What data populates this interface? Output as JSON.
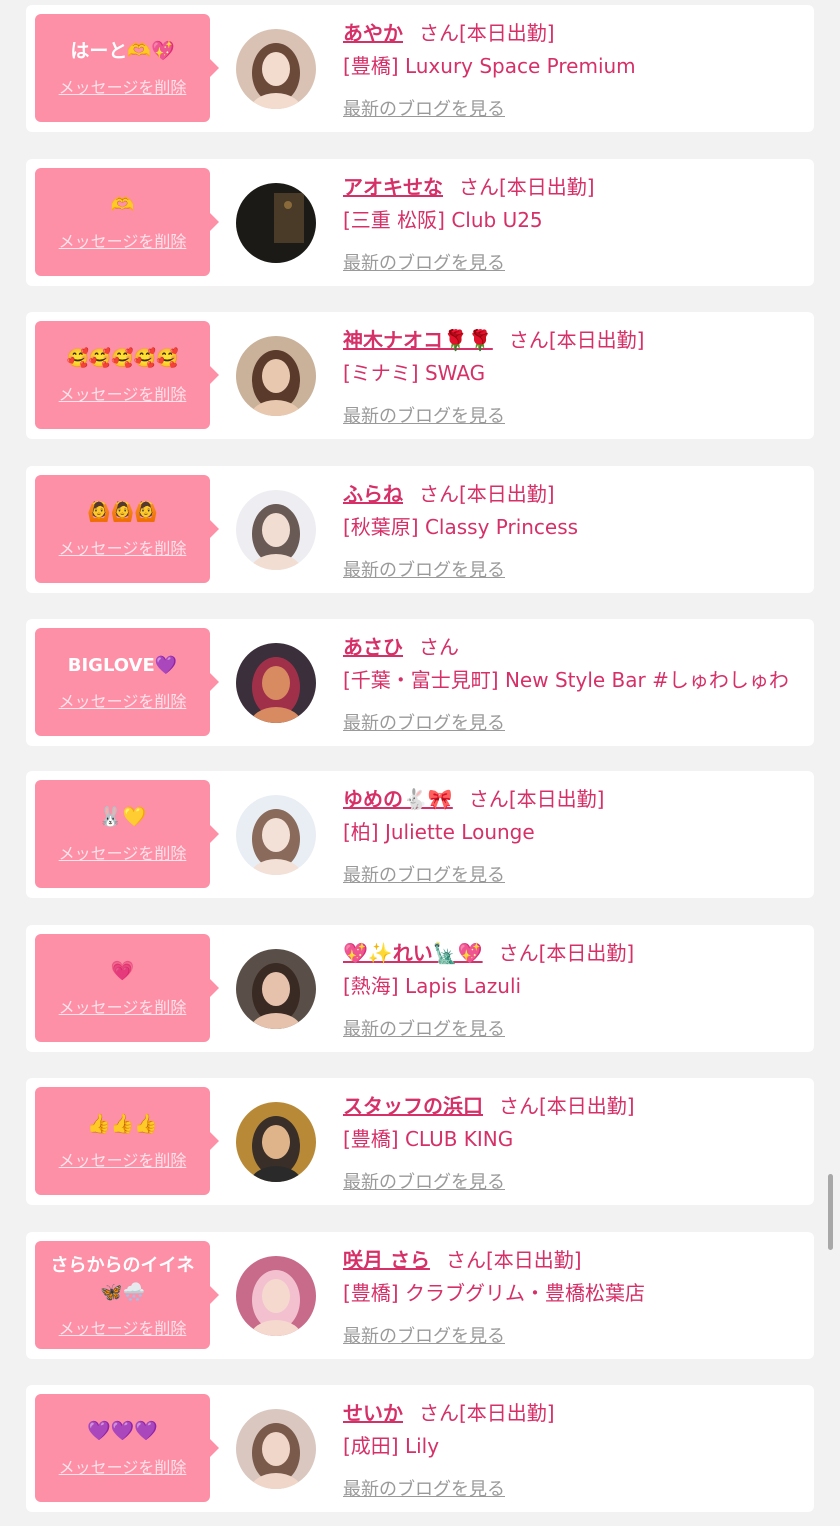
{
  "common": {
    "delete_label": "メッセージを削除",
    "blog_label": "最新のブログを見る",
    "san_label": "さん"
  },
  "colors": {
    "page_bg": "#f2f2f2",
    "bubble": "#fd8fa6",
    "accent": "#d63068",
    "link_gray": "#9a9a9a"
  },
  "items": [
    {
      "message": "はーと🫶💖",
      "name": "あやか",
      "status": "[本日出勤]",
      "shop": "[豊橋] Luxury Space Premium",
      "avatar": "avatar-woman-icon"
    },
    {
      "message": "🫶",
      "name": "アオキせな",
      "status": "[本日出勤]",
      "shop": "[三重 松阪] Club U25",
      "avatar": "avatar-night-icon"
    },
    {
      "message": "🥰🥰🥰🥰🥰",
      "name": "神木ナオコ🌹🌹",
      "status": "[本日出勤]",
      "shop": "[ミナミ] SWAG",
      "avatar": "avatar-woman-icon"
    },
    {
      "message": "🙆🙆🙆",
      "name": "ふらね",
      "status": "[本日出勤]",
      "shop": "[秋葉原] Classy Princess",
      "avatar": "avatar-woman-icon"
    },
    {
      "message": "BIGLOVE💜",
      "name": "あさひ",
      "status": "",
      "shop": "[千葉・富士見町] New Style Bar #しゅわしゅわ",
      "avatar": "avatar-woman-icon"
    },
    {
      "message": "🐰💛",
      "name": "ゆめの🐇🎀",
      "status": "[本日出勤]",
      "shop": "[柏] Juliette Lounge",
      "avatar": "avatar-woman-icon"
    },
    {
      "message": "💗",
      "name": "💖✨れい🗽💖",
      "status": "[本日出勤]",
      "shop": "[熱海] Lapis Lazuli",
      "avatar": "avatar-woman-icon"
    },
    {
      "message": "👍👍👍",
      "name": "スタッフの浜口",
      "status": "[本日出勤]",
      "shop": "[豊橋] CLUB KING",
      "avatar": "avatar-man-icon"
    },
    {
      "message": "さらからのイイネ🦋🌨️",
      "name": "咲月 さら",
      "status": "[本日出勤]",
      "shop": "[豊橋] クラブグリム・豊橋松葉店",
      "avatar": "avatar-woman-icon"
    },
    {
      "message": "💜💜💜",
      "name": "せいか",
      "status": "[本日出勤]",
      "shop": "[成田] Lily",
      "avatar": "avatar-woman-icon"
    }
  ]
}
